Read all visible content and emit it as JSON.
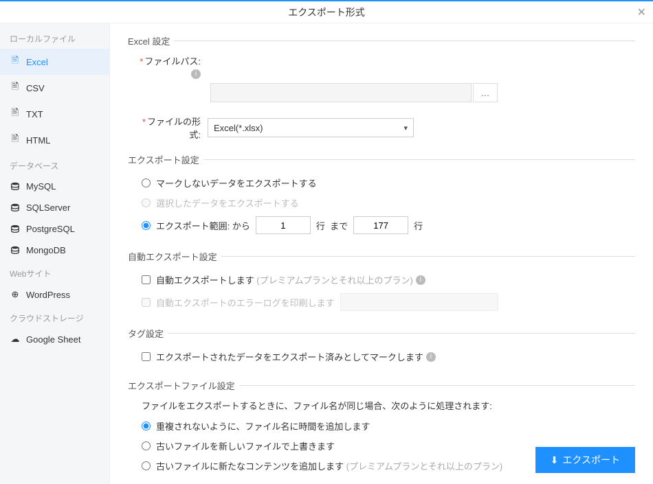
{
  "title": "エクスポート形式",
  "sidebar": {
    "groups": [
      {
        "label": "ローカルファイル",
        "items": [
          {
            "label": "Excel",
            "icon": "file",
            "active": true
          },
          {
            "label": "CSV",
            "icon": "file"
          },
          {
            "label": "TXT",
            "icon": "file"
          },
          {
            "label": "HTML",
            "icon": "file"
          }
        ]
      },
      {
        "label": "データベース",
        "items": [
          {
            "label": "MySQL",
            "icon": "db"
          },
          {
            "label": "SQLServer",
            "icon": "db"
          },
          {
            "label": "PostgreSQL",
            "icon": "db"
          },
          {
            "label": "MongoDB",
            "icon": "db"
          }
        ]
      },
      {
        "label": "Webサイト",
        "items": [
          {
            "label": "WordPress",
            "icon": "globe"
          }
        ]
      },
      {
        "label": "クラウドストレージ",
        "items": [
          {
            "label": "Google Sheet",
            "icon": "cloud"
          }
        ]
      }
    ]
  },
  "excelSettings": {
    "title": "Excel 設定",
    "filePathLabel": "ファイルパス:",
    "browseBtn": "…",
    "fileFormatLabel": "ファイルの形式:",
    "fileFormatValue": "Excel(*.xlsx)"
  },
  "exportSettings": {
    "title": "エクスポート設定",
    "opt1": "マークしないデータをエクスポートする",
    "opt2": "選択したデータをエクスポートする",
    "opt3prefix": "エクスポート範囲: から",
    "rowLabel1": "行",
    "toLabel": "まで",
    "rowLabel2": "行",
    "fromValue": "1",
    "toValue": "177"
  },
  "autoExport": {
    "title": "自動エクスポート設定",
    "chk1": "自動エクスポートします",
    "chk1note": "(プレミアムプランとそれ以上のプラン)",
    "chk2": "自動エクスポートのエラーログを印刷します"
  },
  "tagSettings": {
    "title": "タグ設定",
    "chk": "エクスポートされたデータをエクスポート済みとしてマークします"
  },
  "fileSettings": {
    "title": "エクスポートファイル設定",
    "desc": "ファイルをエクスポートするときに、ファイル名が同じ場合、次のように処理されます:",
    "opt1": "重複されないように、ファイル名に時間を追加します",
    "opt2": "古いファイルを新しいファイルで上書きます",
    "opt3": "古いファイルに新たなコンテンツを追加します",
    "opt3note": "(プレミアムプランとそれ以上のプラン)"
  },
  "exportBtn": "エクスポート"
}
